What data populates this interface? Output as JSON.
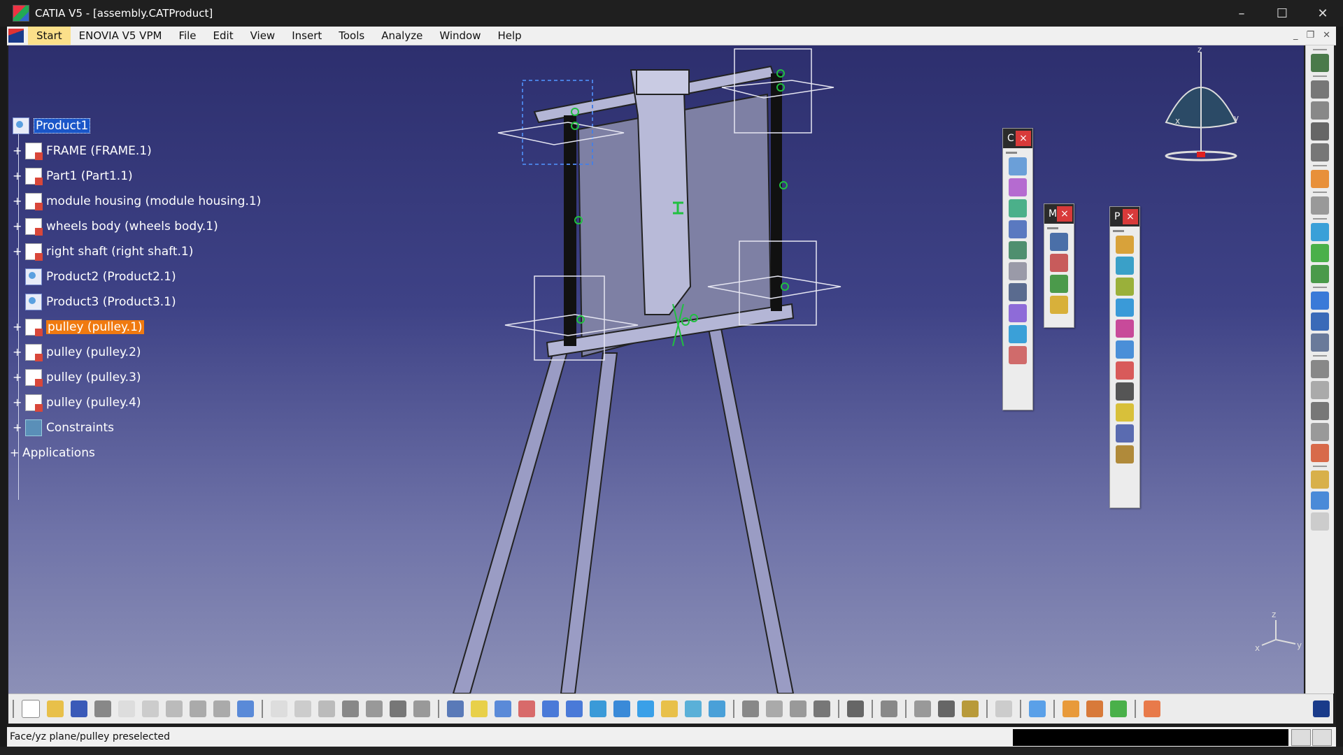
{
  "window": {
    "title": "CATIA V5 - [assembly.CATProduct]",
    "controls": {
      "minimize": "–",
      "maximize": "☐",
      "close": "✕"
    }
  },
  "menu": {
    "items": [
      "Start",
      "ENOVIA V5 VPM",
      "File",
      "Edit",
      "View",
      "Insert",
      "Tools",
      "Analyze",
      "Window",
      "Help"
    ],
    "active": "Start",
    "mdi_controls": {
      "minimize": "_",
      "restore": "❐",
      "close": "✕"
    }
  },
  "tree": {
    "root": "Product1",
    "nodes": [
      {
        "label": "FRAME (FRAME.1)",
        "icon": "part-icon",
        "expandable": true
      },
      {
        "label": "Part1 (Part1.1)",
        "icon": "part-icon",
        "expandable": true
      },
      {
        "label": "module housing (module housing.1)",
        "icon": "part-icon",
        "expandable": true
      },
      {
        "label": "wheels body (wheels body.1)",
        "icon": "part-icon",
        "expandable": true
      },
      {
        "label": "right shaft (right shaft.1)",
        "icon": "part-icon",
        "expandable": true
      },
      {
        "label": "Product2 (Product2.1)",
        "icon": "product-icon",
        "expandable": false
      },
      {
        "label": "Product3 (Product3.1)",
        "icon": "product-icon",
        "expandable": false
      },
      {
        "label": "pulley (pulley.1)",
        "icon": "part-icon",
        "expandable": true,
        "highlighted": true
      },
      {
        "label": "pulley (pulley.2)",
        "icon": "part-icon",
        "expandable": true
      },
      {
        "label": "pulley (pulley.3)",
        "icon": "part-icon",
        "expandable": true
      },
      {
        "label": "pulley (pulley.4)",
        "icon": "part-icon",
        "expandable": true
      },
      {
        "label": "Constraints",
        "icon": "constraints-icon",
        "expandable": true
      }
    ],
    "applications": "Applications"
  },
  "floating_toolbars": [
    {
      "title": "C",
      "close": "×"
    },
    {
      "title": "M",
      "close": "×"
    },
    {
      "title": "P",
      "close": "×"
    }
  ],
  "compass": {
    "x": "x",
    "y": "y",
    "z": "z"
  },
  "axis": {
    "x": "x",
    "y": "y",
    "z": "z"
  },
  "status": {
    "text": "Face/yz plane/pulley preselected"
  },
  "colors": {
    "viewport_top": "#2d2f6e",
    "viewport_bottom": "#8c90b7",
    "selection": "#1a56c8",
    "highlight": "#f07a10",
    "constraint": "#20c040"
  }
}
